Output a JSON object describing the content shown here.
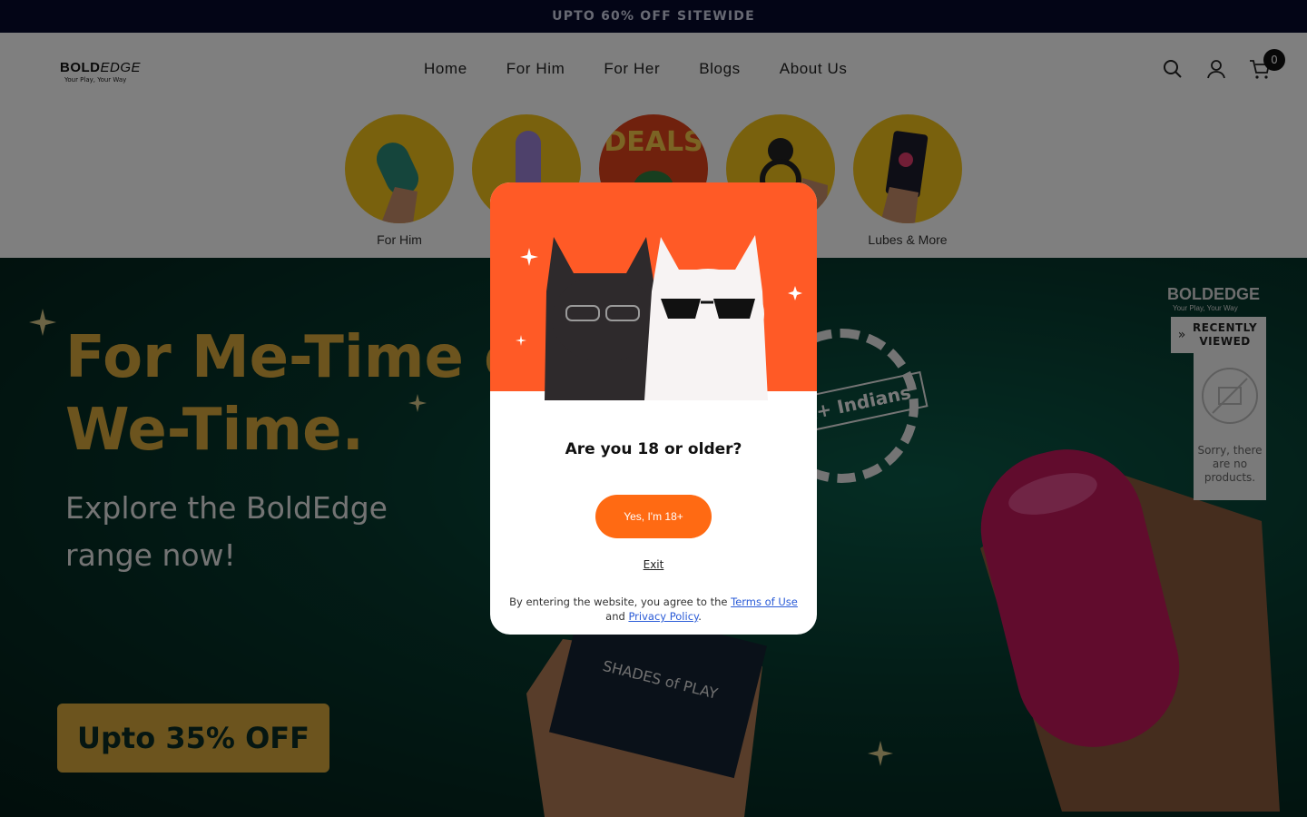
{
  "announcement": {
    "text": "UPTO 60% OFF SITEWIDE"
  },
  "header": {
    "logo": {
      "wordmark_bold": "BOLD",
      "wordmark_italic": "EDGE",
      "tagline": "Your Play, Your Way"
    },
    "nav": [
      "Home",
      "For Him",
      "For Her",
      "Blogs",
      "About Us"
    ],
    "cart_count": "0"
  },
  "categories": [
    {
      "label": "For Him"
    },
    {
      "label": ""
    },
    {
      "label": ""
    },
    {
      "label": ""
    },
    {
      "label": "Lubes & More"
    }
  ],
  "category_art_text": "DEALS",
  "hero": {
    "title_line1": "For Me-Time or",
    "title_line2": "We-Time.",
    "subtitle_line1": "Explore the BoldEdge",
    "subtitle_line2": "range now!",
    "badge": "Upto 35% OFF",
    "seal_text": "x+ Indians",
    "box_text": "SHADES of PLAY"
  },
  "recently_viewed": {
    "brand": "BOLDEDGE",
    "brand_tagline": "Your Play, Your Way",
    "title_line1": "RECENTLY",
    "title_line2": "VIEWED",
    "empty_text": "Sorry, there are no products."
  },
  "age_modal": {
    "question": "Are you 18 or older?",
    "confirm_label": "Yes, I'm 18+",
    "exit_label": "Exit",
    "legal_prefix": "By entering the website, you agree to the",
    "terms_label": "Terms of Use",
    "legal_and": "and",
    "privacy_label": "Privacy Policy",
    "legal_suffix": "."
  },
  "colors": {
    "announcement_bg": "#070b2c",
    "accent_orange": "#ff6a13",
    "hero_gold": "#d9a93d",
    "hero_green": "#06382d",
    "category_yellow": "#f2c21b"
  },
  "icons": [
    "search-icon",
    "user-icon",
    "cart-icon",
    "double-chevron-right-icon",
    "no-image-icon",
    "sparkle-icon"
  ]
}
